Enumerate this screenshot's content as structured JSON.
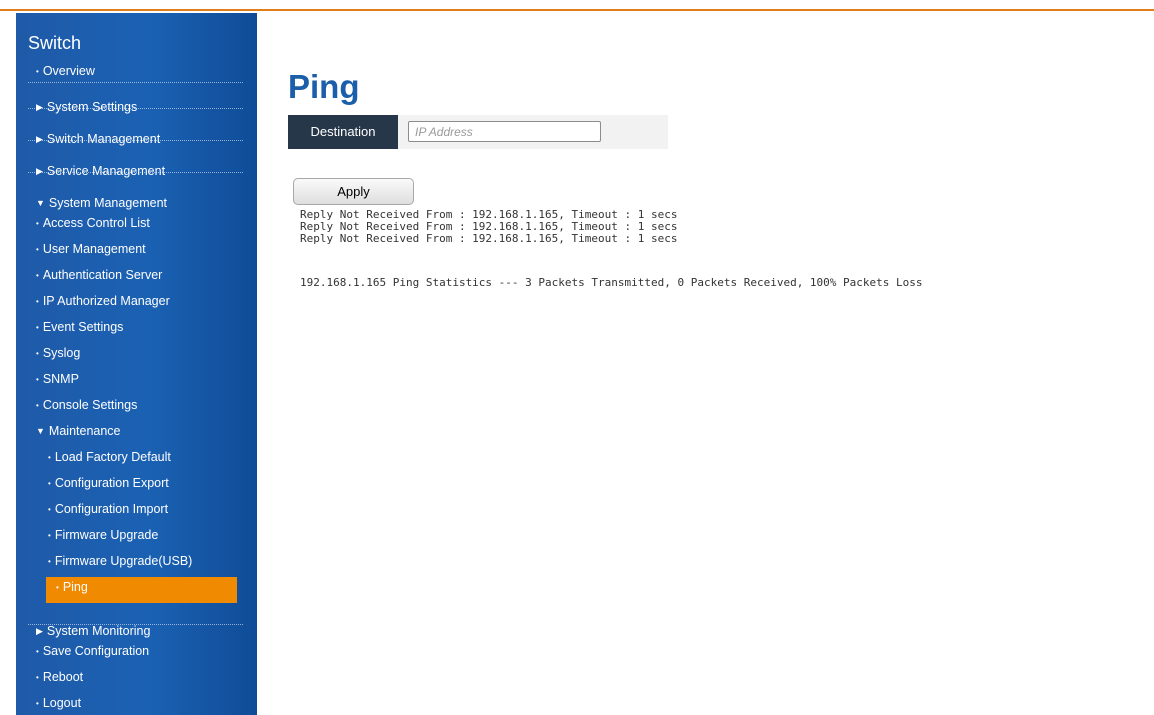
{
  "sidebar": {
    "title": "Switch",
    "items": [
      {
        "label": "Overview",
        "marker": "•"
      },
      {
        "label": "System Settings",
        "marker": "▶"
      },
      {
        "label": "Switch Management",
        "marker": "▶"
      },
      {
        "label": "Service Management",
        "marker": "▶"
      },
      {
        "label": "System Management",
        "marker": "▼"
      },
      {
        "label": "Access Control List",
        "marker": "•"
      },
      {
        "label": "User Management",
        "marker": "•"
      },
      {
        "label": "Authentication Server",
        "marker": "•"
      },
      {
        "label": "IP Authorized Manager",
        "marker": "•"
      },
      {
        "label": "Event Settings",
        "marker": "•"
      },
      {
        "label": "Syslog",
        "marker": "•"
      },
      {
        "label": "SNMP",
        "marker": "•"
      },
      {
        "label": "Console Settings",
        "marker": "•"
      },
      {
        "label": "Maintenance",
        "marker": "▼"
      },
      {
        "label": "Load Factory Default",
        "marker": "•"
      },
      {
        "label": "Configuration Export",
        "marker": "•"
      },
      {
        "label": "Configuration Import",
        "marker": "•"
      },
      {
        "label": "Firmware Upgrade",
        "marker": "•"
      },
      {
        "label": "Firmware Upgrade(USB)",
        "marker": "•"
      },
      {
        "label": "Ping",
        "marker": "•"
      },
      {
        "label": "System Monitoring",
        "marker": "▶"
      },
      {
        "label": "Save Configuration",
        "marker": "•"
      },
      {
        "label": "Reboot",
        "marker": "•"
      },
      {
        "label": "Logout",
        "marker": "•"
      }
    ]
  },
  "main": {
    "title": "Ping",
    "destination": {
      "label": "Destination",
      "placeholder": "IP Address",
      "value": ""
    },
    "apply_label": "Apply",
    "output_lines": [
      "Reply Not Received From : 192.168.1.165, Timeout : 1 secs",
      "Reply Not Received From : 192.168.1.165, Timeout : 1 secs",
      "Reply Not Received From : 192.168.1.165, Timeout : 1 secs"
    ],
    "statistics": "192.168.1.165 Ping Statistics --- 3 Packets Transmitted, 0 Packets Received, 100% Packets Loss"
  },
  "colors": {
    "sidebar_blue": "#1b61b3",
    "active_orange": "#f08a00",
    "title_blue": "#1b5eaa",
    "label_dark": "#26374a",
    "top_rule": "#e07e1b"
  }
}
